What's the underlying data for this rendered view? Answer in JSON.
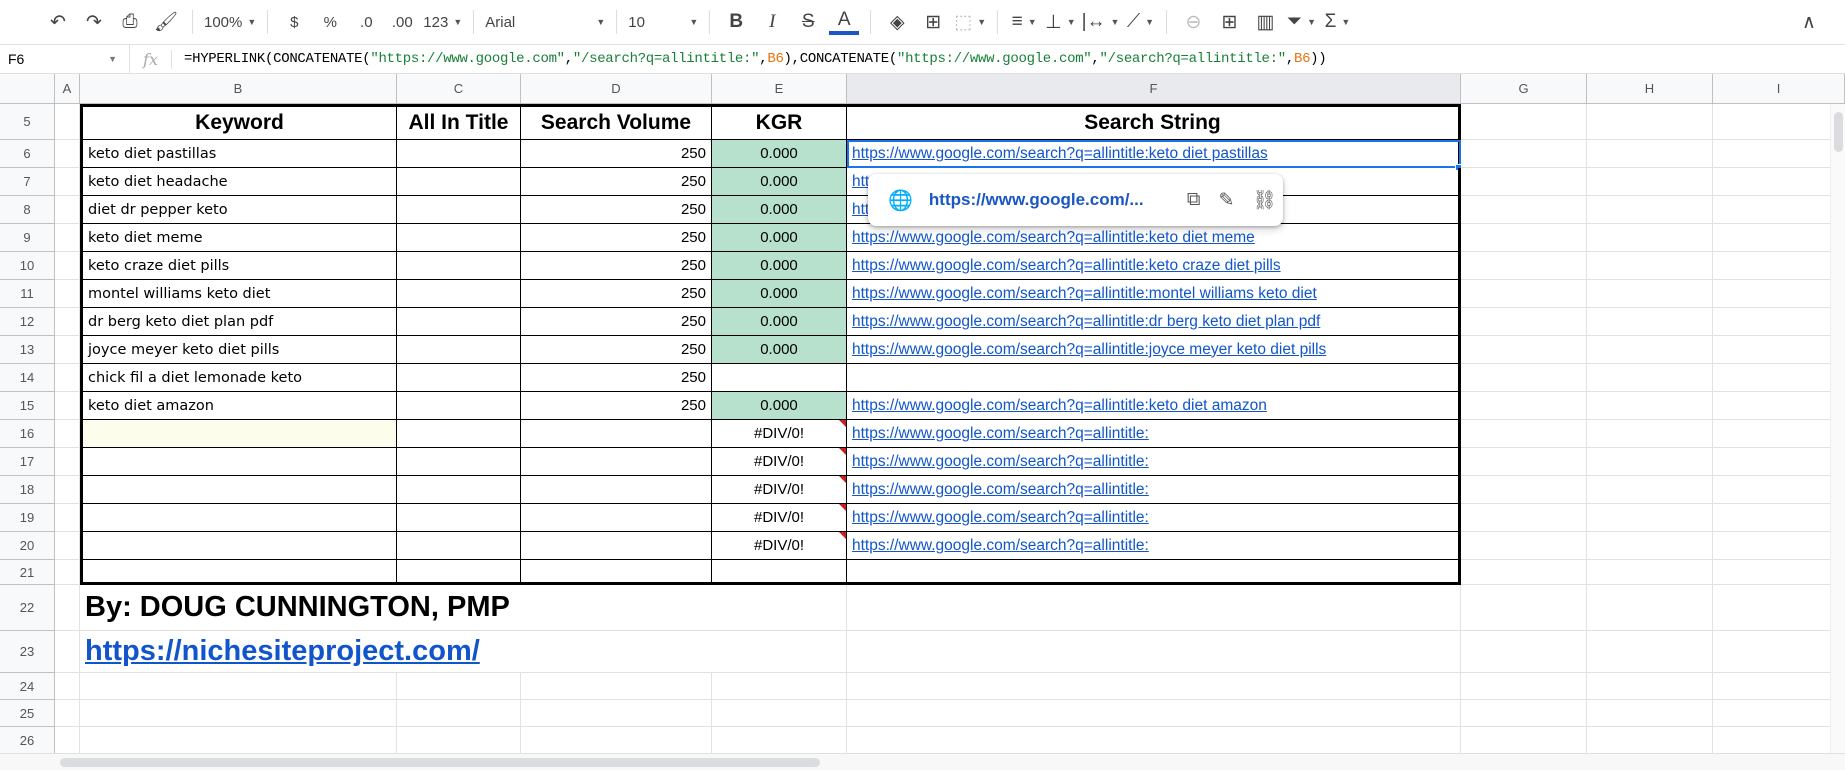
{
  "toolbar": {
    "zoom": "100%",
    "currency": "$",
    "percent": "%",
    "dec_decrease": ".0",
    "dec_increase": ".00",
    "format_more": "123",
    "font": "Arial",
    "font_size": "10",
    "bold": "B",
    "italic": "I",
    "strike": "S",
    "text_color": "A",
    "sum": "Σ"
  },
  "formula_bar": {
    "cell_ref": "F6",
    "fx": "fx",
    "p1": "=HYPERLINK(CONCATENATE(",
    "s1": "\"https://www.google.com\"",
    "c1": ",",
    "s2": "\"/search?q=allintitle:\"",
    "c2": ",",
    "r1": "B6",
    "p2": "),CONCATENATE(",
    "s3": "\"https://www.google.com\"",
    "c3": ",",
    "s4": "\"/search?q=allintitle:\"",
    "c4": ",",
    "r2": "B6",
    "p3": "))"
  },
  "columns": [
    "A",
    "B",
    "C",
    "D",
    "E",
    "F",
    "G",
    "H",
    "I"
  ],
  "header_row": {
    "num": "5",
    "keyword": "Keyword",
    "allintitle": "All In Title",
    "volume": "Search Volume",
    "kgr": "KGR",
    "search": "Search String"
  },
  "rows": [
    {
      "num": "6",
      "keyword": "keto diet pastillas",
      "volume": "250",
      "kgr": "0.000",
      "link": "https://www.google.com/search?q=allintitle:keto diet pastillas"
    },
    {
      "num": "7",
      "keyword": "keto diet headache",
      "volume": "250",
      "kgr": "0.000",
      "link": "https://www.google.com/search?q=allintitle:keto diet headache"
    },
    {
      "num": "8",
      "keyword": "diet dr pepper keto",
      "volume": "250",
      "kgr": "0.000",
      "link": "https://www.google.com/search?q=allintitle:diet dr pepper keto"
    },
    {
      "num": "9",
      "keyword": "keto diet meme",
      "volume": "250",
      "kgr": "0.000",
      "link": "https://www.google.com/search?q=allintitle:keto diet meme"
    },
    {
      "num": "10",
      "keyword": "keto craze diet pills",
      "volume": "250",
      "kgr": "0.000",
      "link": "https://www.google.com/search?q=allintitle:keto craze diet pills"
    },
    {
      "num": "11",
      "keyword": "montel williams keto diet",
      "volume": "250",
      "kgr": "0.000",
      "link": "https://www.google.com/search?q=allintitle:montel williams keto diet"
    },
    {
      "num": "12",
      "keyword": "dr berg keto diet plan pdf",
      "volume": "250",
      "kgr": "0.000",
      "link": "https://www.google.com/search?q=allintitle:dr berg keto diet plan pdf"
    },
    {
      "num": "13",
      "keyword": "joyce meyer keto diet pills",
      "volume": "250",
      "kgr": "0.000",
      "link": "https://www.google.com/search?q=allintitle:joyce meyer keto diet pills"
    },
    {
      "num": "14",
      "keyword": "chick fil a diet lemonade keto",
      "volume": "250",
      "kgr": "",
      "link": ""
    },
    {
      "num": "15",
      "keyword": "keto diet amazon",
      "volume": "250",
      "kgr": "0.000",
      "link": "https://www.google.com/search?q=allintitle:keto diet amazon"
    },
    {
      "num": "16",
      "keyword": "",
      "volume": "",
      "kgr": "#DIV/0!",
      "link": "https://www.google.com/search?q=allintitle:"
    },
    {
      "num": "17",
      "keyword": "",
      "volume": "",
      "kgr": "#DIV/0!",
      "link": "https://www.google.com/search?q=allintitle:"
    },
    {
      "num": "18",
      "keyword": "",
      "volume": "",
      "kgr": "#DIV/0!",
      "link": "https://www.google.com/search?q=allintitle:"
    },
    {
      "num": "19",
      "keyword": "",
      "volume": "",
      "kgr": "#DIV/0!",
      "link": "https://www.google.com/search?q=allintitle:"
    },
    {
      "num": "20",
      "keyword": "",
      "volume": "",
      "kgr": "#DIV/0!",
      "link": "https://www.google.com/search?q=allintitle:"
    },
    {
      "num": "21",
      "keyword": "",
      "volume": "",
      "kgr": "",
      "link": ""
    }
  ],
  "footer": {
    "row22_num": "22",
    "author": "By: DOUG CUNNINGTON, PMP",
    "row23_num": "23",
    "site": "https://nichesiteproject.com/",
    "extra_rows": [
      "24",
      "25",
      "26"
    ]
  },
  "tooltip": {
    "url": "https://www.google.com/..."
  },
  "colors": {
    "kgr_green": "#b7e1cd",
    "link": "#1155cc",
    "selection": "#1a73e8",
    "error": "#c5221f"
  }
}
